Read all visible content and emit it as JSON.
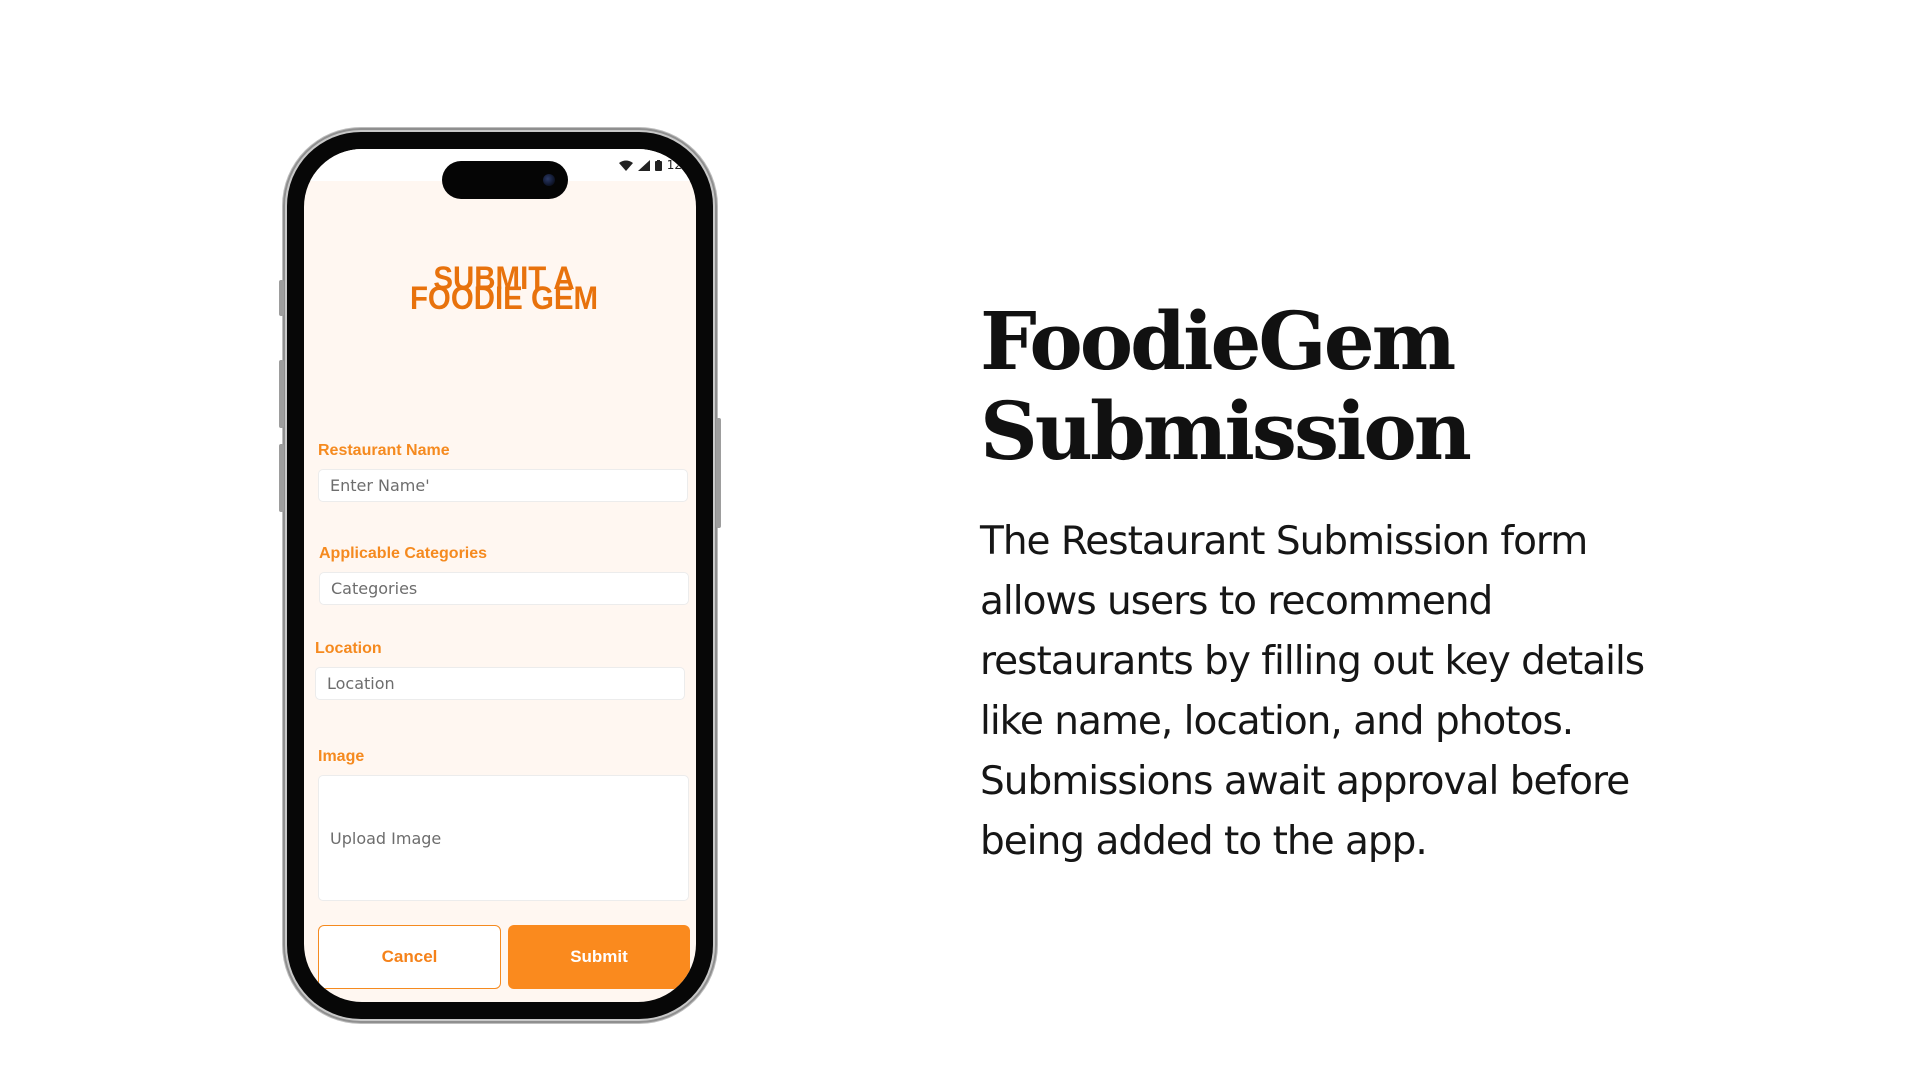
{
  "status_bar": {
    "time": "12"
  },
  "form": {
    "title_line1": "SUBMIT A",
    "title_line2": "FOODIE GEM",
    "fields": {
      "restaurant_name": {
        "label": "Restaurant Name",
        "placeholder": "Enter Name'"
      },
      "categories": {
        "label": "Applicable Categories",
        "placeholder": "Categories"
      },
      "location": {
        "label": "Location",
        "placeholder": "Location"
      },
      "image": {
        "label": "Image",
        "placeholder": "Upload Image"
      }
    },
    "cancel_label": "Cancel",
    "submit_label": "Submit"
  },
  "headline": {
    "line1": "FoodieGem",
    "line2": "Submission"
  },
  "description": "The Restaurant Submission form allows users to recommend restaurants by filling out key details like name, location, and photos. Submissions await approval before being added to the app.",
  "colors": {
    "accent": "#F58A1F",
    "title": "#E8720C",
    "screen_bg": "#FFF7F1",
    "text": "#161616"
  }
}
